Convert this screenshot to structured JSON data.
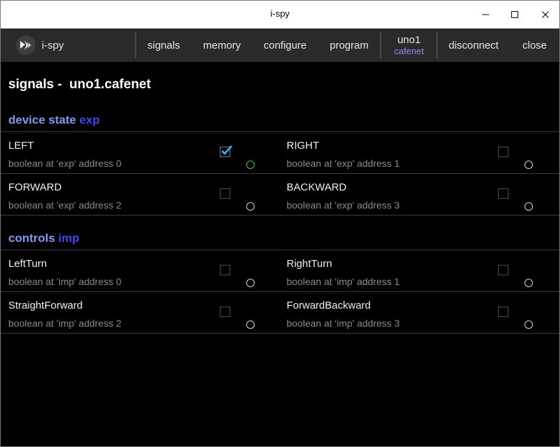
{
  "window": {
    "title": "i-spy"
  },
  "appbar": {
    "app_name": "i-spy",
    "nav": {
      "signals": "signals",
      "memory": "memory",
      "configure": "configure",
      "program": "program",
      "device_name": "uno1",
      "device_host": "cafenet",
      "disconnect": "disconnect",
      "close": "close"
    }
  },
  "page": {
    "title": "signals -  uno1.cafenet"
  },
  "sections": [
    {
      "title": "device state",
      "tag": "exp",
      "signals": [
        {
          "name": "LEFT",
          "desc": "boolean at 'exp' address 0",
          "checked": true,
          "active": true
        },
        {
          "name": "RIGHT",
          "desc": "boolean at 'exp' address 1",
          "checked": false,
          "active": false
        },
        {
          "name": "FORWARD",
          "desc": "boolean at 'exp' address 2",
          "checked": false,
          "active": false
        },
        {
          "name": "BACKWARD",
          "desc": "boolean at 'exp' address 3",
          "checked": false,
          "active": false
        }
      ]
    },
    {
      "title": "controls",
      "tag": "imp",
      "signals": [
        {
          "name": "LeftTurn",
          "desc": "boolean at 'imp' address 0",
          "checked": false,
          "active": false
        },
        {
          "name": "RightTurn",
          "desc": "boolean at 'imp' address 1",
          "checked": false,
          "active": false
        },
        {
          "name": "StraightForward",
          "desc": "boolean at 'imp' address 2",
          "checked": false,
          "active": false
        },
        {
          "name": "ForwardBackward",
          "desc": "boolean at 'imp' address 3",
          "checked": false,
          "active": false
        }
      ]
    }
  ],
  "colors": {
    "section_title": "#7e9cf6",
    "section_tag": "#4343f0",
    "device_host": "#8e8cf0",
    "led_active": "#2bd42b",
    "check_accent": "#33a7e8"
  },
  "icons": {
    "logo": "kivy-logo-icon",
    "minimize": "minimize-icon",
    "maximize": "maximize-icon",
    "close": "close-icon",
    "checkbox": "checkbox-icon",
    "checkmark": "checkmark-icon",
    "led": "status-led-icon"
  }
}
